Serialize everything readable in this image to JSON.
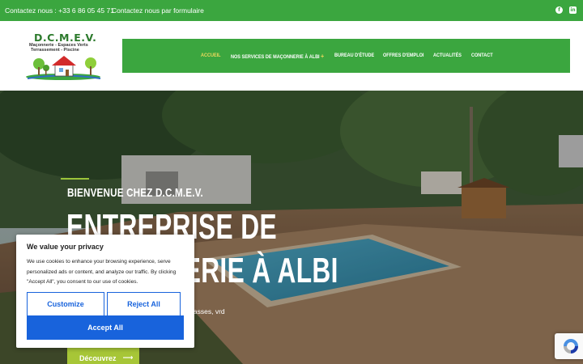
{
  "topbar": {
    "phone": "Contactez nous : +33 6 86 05 45 71",
    "form_link": "Contactez nous par formulaire",
    "facebook_icon": "facebook-icon",
    "linkedin_icon": "linkedin-icon"
  },
  "logo": {
    "title": "D.C.M.E.V.",
    "line1": "Maçonnerie - Espaces Verts",
    "line2": "Terrassement - Piscine"
  },
  "nav": {
    "items": [
      {
        "label": "ACCUEIL",
        "active": true
      },
      {
        "label": "NOS SERVICES DE MAÇONNERIE À ALBI",
        "has_dropdown": true
      },
      {
        "label": "BUREAU D'ÉTUDE"
      },
      {
        "label": "OFFRES D'EMPLOI"
      },
      {
        "label": "ACTUALITÉS"
      },
      {
        "label": "CONTACT"
      }
    ],
    "dropdown_symbol": "+"
  },
  "hero": {
    "welcome": "BIENVENUE CHEZ D.C.M.E.V.",
    "title_line1": "ENTREPRISE DE",
    "title_line2": "MAÇONNERIE À ALBI",
    "description": "Maçonnerie, terrassements, piscines, terrasses, vrd",
    "button_label": "Découvrez",
    "button_icon": "arrow-right-icon"
  },
  "cookie_banner": {
    "title": "We value your privacy",
    "text": "We use cookies to enhance your browsing experience, serve personalized ads or content, and analyze our traffic. By clicking \"Accept All\", you consent to our use of cookies.",
    "customize_label": "Customize",
    "reject_label": "Reject All",
    "accept_label": "Accept All"
  },
  "colors": {
    "brand_green": "#3ba63f",
    "active_nav": "#ecd95c",
    "button_lime": "#a7c637",
    "cookie_blue": "#1863dc"
  }
}
